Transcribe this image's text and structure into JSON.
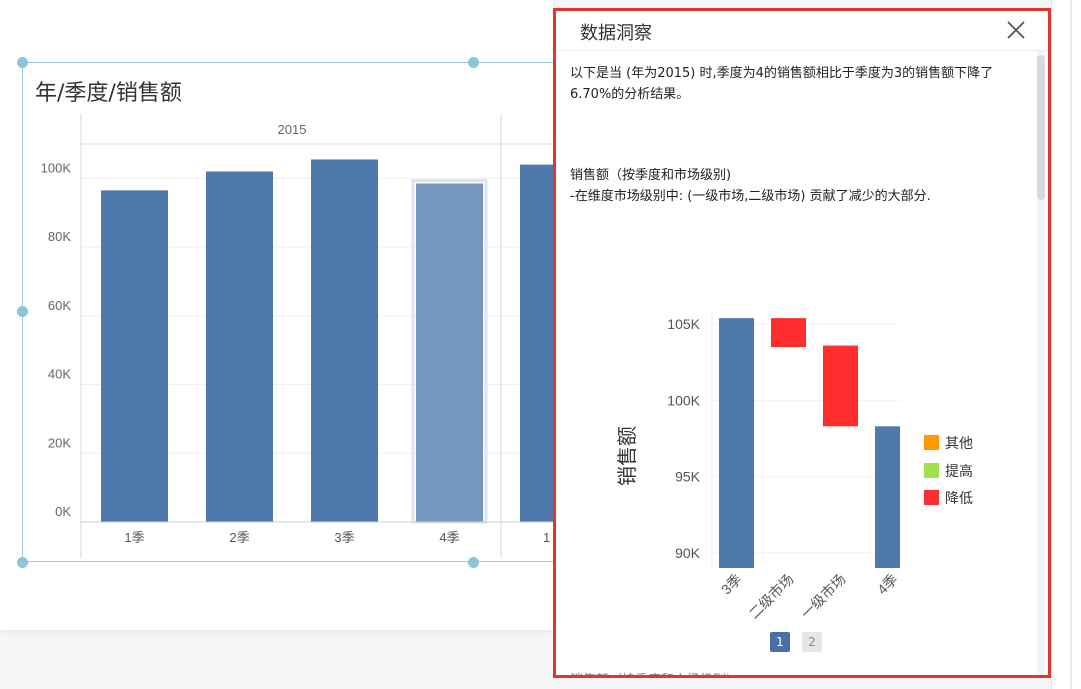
{
  "widget": {
    "title": "年/季度/销售额"
  },
  "main_chart": {
    "year_label": "2015",
    "y_ticks": [
      "0K",
      "20K",
      "40K",
      "60K",
      "80K",
      "100K"
    ],
    "next_partial_label": "1"
  },
  "panel": {
    "title": "数据洞察",
    "intro": "以下是当 (年为2015) 时,季度为4的销售额相比于季度为3的销售额下降了6.70%的分析结果。",
    "section_title": "销售额（按季度和市场级别)",
    "section_desc": "-在维度市场级别中: (一级市场,二级市场) 贡献了减少的大部分.",
    "legend": [
      {
        "label": "其他",
        "color": "#ff9900"
      },
      {
        "label": "提高",
        "color": "#a3e04b"
      },
      {
        "label": "降低",
        "color": "#ff2d2d"
      }
    ],
    "pagination": [
      "1",
      "2"
    ],
    "truncated_next": "销售额（按季度和市场级别)"
  },
  "colors": {
    "bar": "#4e79aa",
    "bar_selected": "#7597bd",
    "decrease": "#ff2d2d",
    "accent_border": "#e5342b"
  },
  "chart_data": [
    {
      "type": "bar",
      "title": "年/季度/销售额",
      "group": "2015",
      "categories": [
        "1季",
        "2季",
        "3季",
        "4季"
      ],
      "values": [
        96500,
        102000,
        105500,
        98500
      ],
      "selected_category": "4季",
      "ylim": [
        0,
        110000
      ],
      "y_ticks": [
        0,
        20000,
        40000,
        60000,
        80000,
        100000
      ],
      "grid": true
    },
    {
      "type": "bar",
      "subtype": "waterfall",
      "ylabel": "销售额",
      "categories": [
        "3季",
        "二级市场",
        "一级市场",
        "4季"
      ],
      "bars": [
        {
          "category": "3季",
          "from": 0,
          "to": 105400,
          "kind": "total"
        },
        {
          "category": "二级市场",
          "from": 105400,
          "to": 103500,
          "kind": "降低"
        },
        {
          "category": "一级市场",
          "from": 103600,
          "to": 98300,
          "kind": "降低"
        },
        {
          "category": "4季",
          "from": 0,
          "to": 98300,
          "kind": "total"
        }
      ],
      "ylim": [
        89000,
        106000
      ],
      "y_ticks": [
        90000,
        95000,
        100000,
        105000
      ],
      "legend_position": "right"
    }
  ]
}
